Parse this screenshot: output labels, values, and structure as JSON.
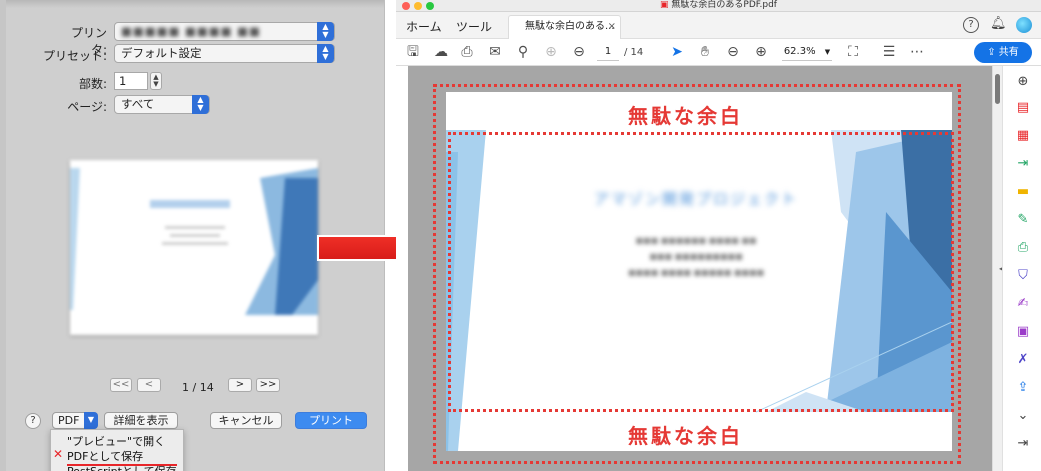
{
  "print_dialog": {
    "printer_label": "プリンタ:",
    "printer_value": "■■■■■ ■■■■ ■■",
    "preset_label": "プリセット:",
    "preset_value": "デフォルト設定",
    "copies_label": "部数:",
    "copies_value": "1",
    "pages_label": "ページ:",
    "pages_value": "すべて",
    "page_indicator": "1 / 14",
    "nav_first": "<<",
    "nav_prev": "<",
    "nav_next": ">",
    "nav_last": ">>",
    "help_label": "?",
    "pdf_label": "PDF",
    "show_details_label": "詳細を表示",
    "cancel_label": "キャンセル",
    "print_label": "プリント",
    "pdf_menu": {
      "items": [
        "\"プレビュー\"で開く",
        "PDFとして保存",
        "PostScriptとして保存"
      ],
      "selected_marker": "✕"
    }
  },
  "acrobat": {
    "window_title": "無駄な余白のあるPDF.pdf",
    "nav_home": "ホーム",
    "nav_tools": "ツール",
    "doc_tab_label": "無駄な余白のある...",
    "doc_tab_close": "×",
    "help_icon_label": "?",
    "page_current": "1",
    "page_total": "/ 14",
    "zoom_value": "62.3%",
    "share_label": "共有",
    "annotation_top": "無駄な余白",
    "annotation_bottom": "無駄な余白",
    "slide_title": "アマゾン開発プロジェクト",
    "slide_lines": [
      "■■■ ■■■■■■ ■■■■ ■■",
      "■■■ ■■■■■■■■■",
      "■■■■ ■■■■ ■■■■■ ■■■■"
    ]
  },
  "colors": {
    "annotation_red": "#e53935",
    "acrobat_blue": "#1473e6",
    "mac_blue": "#2f6fd8"
  },
  "icons": {
    "toolbar": [
      "save-icon",
      "cloud-upload-icon",
      "print-icon",
      "mail-icon",
      "zoom-search-icon",
      "page-up-icon",
      "page-down-icon",
      "select-cursor-icon",
      "hand-icon",
      "zoom-out-icon",
      "zoom-in-icon",
      "page-fit-icon",
      "scroll-mode-icon",
      "more-icon"
    ],
    "right_panel": [
      "search-zoom-icon",
      "create-pdf-icon",
      "organize-pages-icon",
      "export-pdf-icon",
      "comment-icon",
      "edit-pdf-icon",
      "print-production-icon",
      "protect-icon",
      "fill-sign-icon",
      "send-sign-icon",
      "more-tools-icon",
      "share-icon",
      "expand-icon",
      "panel-toggle-icon"
    ]
  }
}
